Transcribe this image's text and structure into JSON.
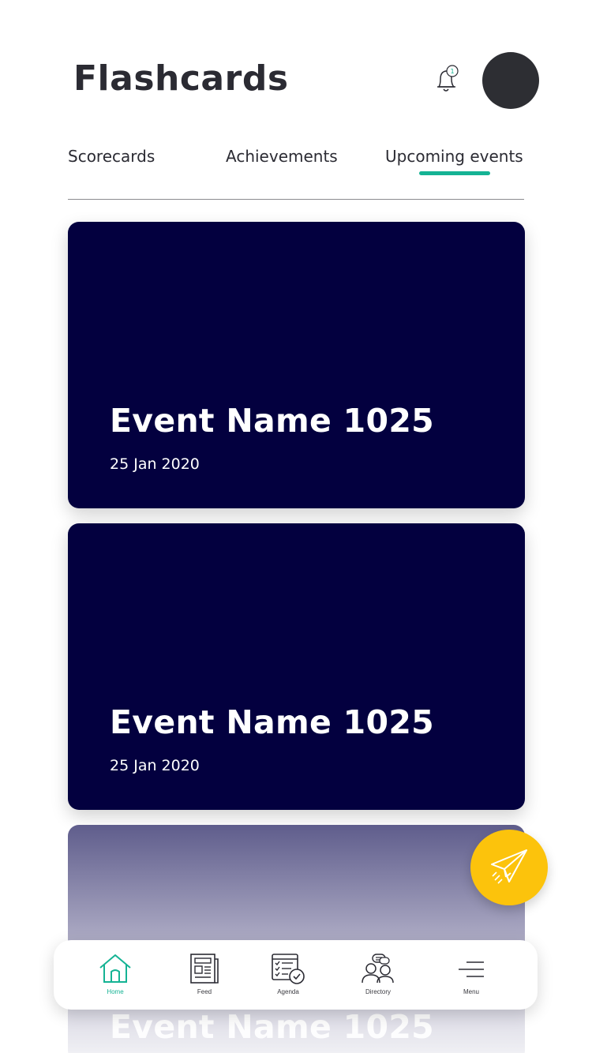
{
  "header": {
    "title": "Flashcards",
    "notification_count": "1"
  },
  "tabs": [
    {
      "label": "Scorecards",
      "active": false
    },
    {
      "label": "Achievements",
      "active": false
    },
    {
      "label": "Upcoming events",
      "active": true
    }
  ],
  "events": [
    {
      "name": "Event Name 1025",
      "date": "25 Jan 2020"
    },
    {
      "name": "Event Name 1025",
      "date": "25 Jan 2020"
    },
    {
      "name": "Event Name 1025",
      "date": ""
    }
  ],
  "bottom_nav": [
    {
      "label": "Home",
      "icon": "home-icon",
      "active": true
    },
    {
      "label": "Feed",
      "icon": "newspaper-icon",
      "active": false
    },
    {
      "label": "Agenda",
      "icon": "agenda-checklist-icon",
      "active": false
    },
    {
      "label": "Directory",
      "icon": "people-icon",
      "active": false
    },
    {
      "label": "Menu",
      "icon": "menu-icon",
      "active": false
    }
  ],
  "colors": {
    "accent": "#15b394",
    "card": "#03003f",
    "fab": "#fcc30c"
  }
}
